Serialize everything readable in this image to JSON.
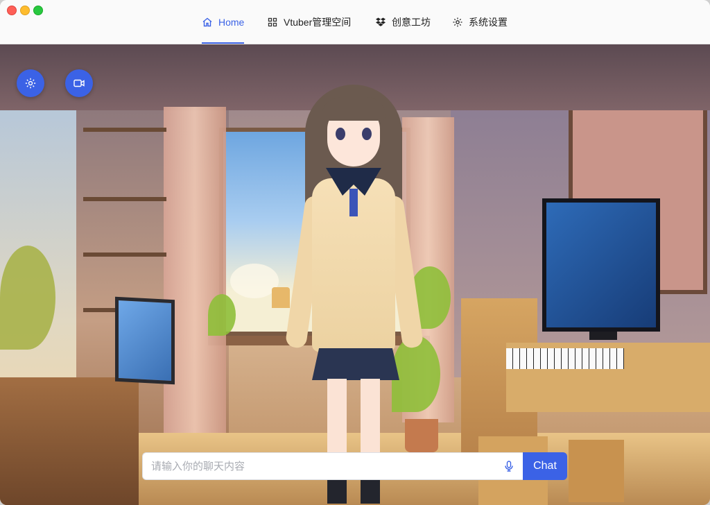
{
  "window": {
    "controls": [
      "close",
      "minimize",
      "zoom"
    ]
  },
  "nav": {
    "items": [
      {
        "label": "Home",
        "icon": "home-icon",
        "active": true
      },
      {
        "label": "Vtuber管理空间",
        "icon": "grid-icon",
        "active": false
      },
      {
        "label": "创意工坊",
        "icon": "dropbox-icon",
        "active": false
      },
      {
        "label": "系统设置",
        "icon": "gear-icon",
        "active": false
      }
    ]
  },
  "toolbar": {
    "buttons": [
      {
        "icon": "gear-icon"
      },
      {
        "icon": "camera-icon"
      }
    ]
  },
  "chat": {
    "placeholder": "请输入你的聊天内容",
    "value": "",
    "mic_icon": "microphone-icon",
    "send_label": "Chat"
  },
  "colors": {
    "accent": "#3b62e6",
    "titlebar": "#fafafa"
  }
}
